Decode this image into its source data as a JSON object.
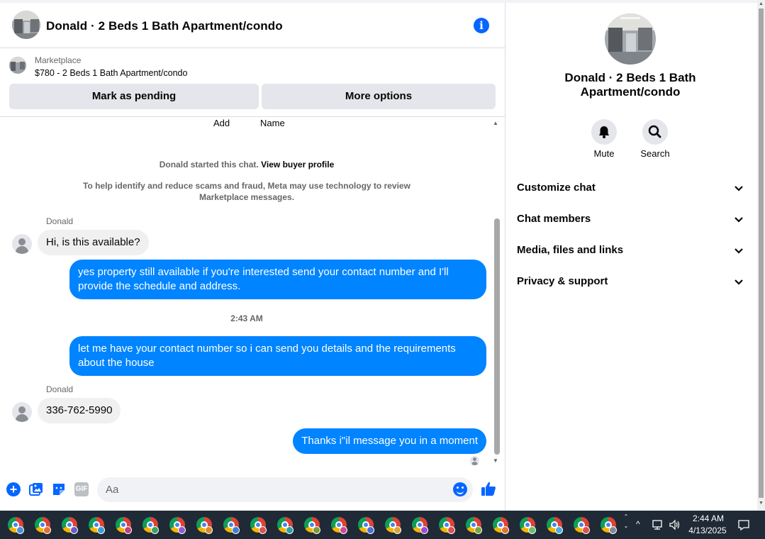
{
  "header": {
    "title": "Donald · 2 Beds 1 Bath Apartment/condo",
    "info_icon": "info-icon"
  },
  "marketplace": {
    "label": "Marketplace",
    "listing": "$780 - 2 Beds 1 Bath Apartment/condo",
    "mark_pending": "Mark as pending",
    "more_options": "More options"
  },
  "messages": {
    "col_add": "Add",
    "col_name": "Name",
    "system_started": "Donald started this chat.",
    "view_profile": "View buyer profile",
    "system_notice": "To help identify and reduce scams and fraud, Meta may use technology to review Marketplace messages.",
    "thread": [
      {
        "from": "Donald",
        "sender_label": "Donald",
        "text": "Hi, is this available?"
      },
      {
        "from": "me",
        "text": "yes property still available if you're interested send your contact number and I'll provide the schedule and address."
      },
      {
        "from": "me",
        "text": "let me have your contact number so i can send you details and the requirements about the house"
      },
      {
        "from": "Donald",
        "sender_label": "Donald",
        "text": "336-762-5990"
      },
      {
        "from": "me",
        "text": "Thanks i\"il message you in a moment"
      }
    ],
    "timestamp": "2:43 AM"
  },
  "composer": {
    "placeholder": "Aa",
    "gif_label": "GIF"
  },
  "right_panel": {
    "title": "Donald · 2 Beds 1 Bath Apartment/condo",
    "mute_label": "Mute",
    "search_label": "Search",
    "sections": [
      "Customize chat",
      "Chat members",
      "Media, files and links",
      "Privacy & support"
    ]
  },
  "taskbar": {
    "time": "2:44 AM",
    "date": "4/13/2025",
    "app_count": 23,
    "badge_colors": [
      "#4a8fd9",
      "#e0713a",
      "#6a5acd",
      "#3c9cd7",
      "#c2417a",
      "#3aa06a",
      "#8f5fd1",
      "#d98c2b",
      "#3c7fd7",
      "#d9534f",
      "#2e9fa6",
      "#7d9b3a",
      "#c94b9c",
      "#4a6fd9",
      "#d9a43a",
      "#9b4ad9",
      "#d9534f",
      "#7aa63c",
      "#e0713a",
      "#6ac06a",
      "#4ab0d9",
      "#d9534f",
      "#7d8b99"
    ]
  },
  "colors": {
    "accent": "#0866ff",
    "outgoing_bubble": "#0084ff",
    "incoming_bubble": "#f0f0f0"
  }
}
